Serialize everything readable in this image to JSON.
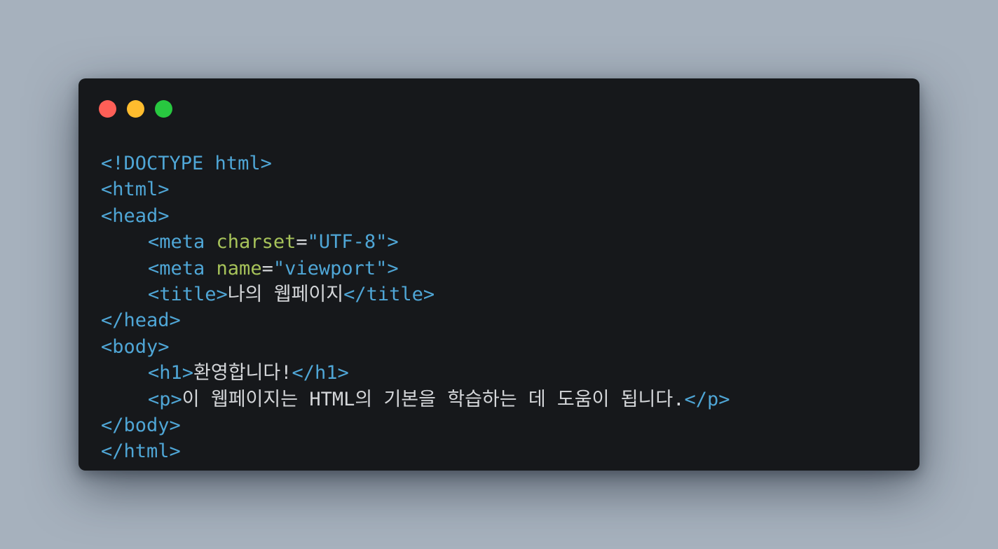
{
  "window": {
    "controls": {
      "close": {
        "icon": "close-dot-icon",
        "color": "#fe5f57"
      },
      "minimize": {
        "icon": "minimize-dot-icon",
        "color": "#febc2e"
      },
      "maximize": {
        "icon": "maximize-dot-icon",
        "color": "#28c840"
      }
    }
  },
  "colors": {
    "background": "#a6b1bd",
    "editor_background": "#16181b",
    "tag": "#4fa6d6",
    "attribute": "#a7c35a",
    "text": "#d4d6d9"
  },
  "code": {
    "lines": [
      {
        "tokens": [
          "<!DOCTYPE html>"
        ]
      },
      {
        "tokens": [
          "<html>"
        ]
      },
      {
        "tokens": [
          "<head>"
        ]
      },
      {
        "tokens": [
          "<meta ",
          "charset",
          "=",
          "\"UTF-8\"",
          ">"
        ]
      },
      {
        "tokens": [
          "<meta ",
          "name",
          "=",
          "\"viewport\"",
          ">"
        ]
      },
      {
        "tokens": [
          "<title>",
          "나의 웹페이지",
          "</title>"
        ]
      },
      {
        "tokens": [
          "</head>"
        ]
      },
      {
        "tokens": [
          "<body>"
        ]
      },
      {
        "tokens": [
          "<h1>",
          "환영합니다!",
          "</h1>"
        ]
      },
      {
        "tokens": [
          "<p>",
          "이 웹페이지는 HTML의 기본을 학습하는 데 도움이 됩니다.",
          "</p>"
        ]
      },
      {
        "tokens": [
          "</body>"
        ]
      },
      {
        "tokens": [
          "</html>"
        ]
      }
    ]
  }
}
